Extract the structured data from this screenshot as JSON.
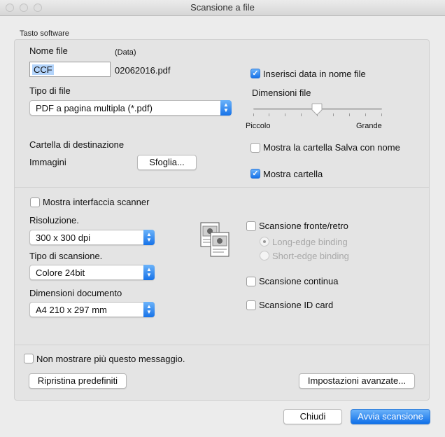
{
  "window": {
    "title": "Scansione a file"
  },
  "section_label": "Tasto software",
  "file": {
    "name_label": "Nome file",
    "date_label": "(Data)",
    "name_value": "CCF",
    "date_value": "02062016.pdf",
    "type_label": "Tipo di file",
    "type_value": "PDF a pagina multipla (*.pdf)",
    "insert_date_label": "Inserisci data in nome file",
    "insert_date_checked": true,
    "size_label": "Dimensioni file",
    "size_min": "Piccolo",
    "size_max": "Grande",
    "size_level": 0.5,
    "dest_label": "Cartella di destinazione",
    "dest_value": "Immagini",
    "browse_label": "Sfoglia...",
    "show_save_as_label": "Mostra la cartella Salva con nome",
    "show_save_as_checked": false,
    "show_folder_label": "Mostra cartella",
    "show_folder_checked": true
  },
  "scan": {
    "show_interface_label": "Mostra interfaccia scanner",
    "resolution_label": "Risoluzione.",
    "resolution_value": "300 x 300 dpi",
    "scan_type_label": "Tipo di scansione.",
    "scan_type_value": "Colore 24bit",
    "doc_size_label": "Dimensioni documento",
    "doc_size_value": "A4 210 x 297 mm",
    "duplex_label": "Scansione fronte/retro",
    "long_edge_label": "Long-edge binding",
    "short_edge_label": "Short-edge binding",
    "continuous_label": "Scansione continua",
    "id_card_label": "Scansione ID card"
  },
  "footer": {
    "dont_show_label": "Non mostrare più questo messaggio.",
    "restore_label": "Ripristina predefiniti",
    "advanced_label": "Impostazioni avanzate...",
    "close_label": "Chiudi",
    "start_label": "Avvia scansione"
  }
}
